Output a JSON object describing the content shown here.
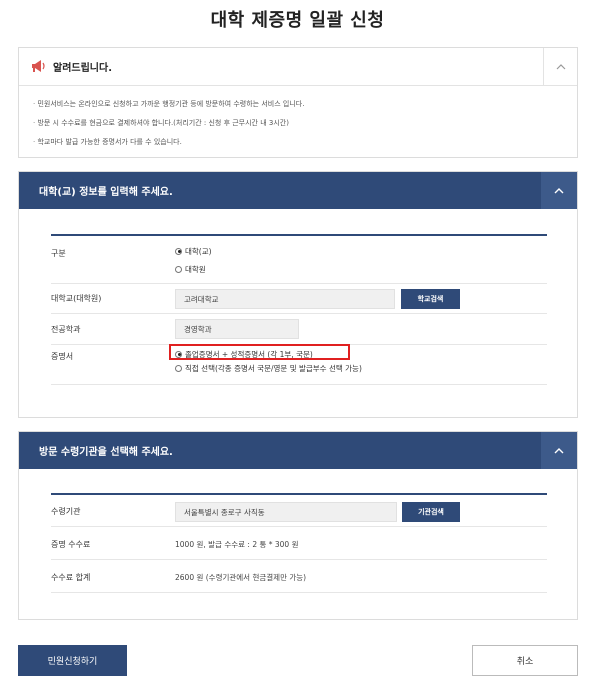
{
  "page": {
    "title": "대학 제증명 일괄 신청"
  },
  "notice": {
    "title": "알려드립니다.",
    "items": [
      "민원서비스는 온라인으로 신청하고 가까운 행정기관 등에 방문하여 수령하는 서비스 입니다.",
      "방문 시 수수료를 현금으로 결제하셔야 합니다.(처리기간 : 신청 후 근무시간 내 3시간)",
      "학교마다 발급 가능한 증명서가 다를 수 있습니다."
    ]
  },
  "school_section": {
    "title": "대학(교) 정보를 입력해 주세요.",
    "category_label": "구분",
    "category_options": [
      "대학(교)",
      "대학원"
    ],
    "category_selected": "대학(교)",
    "school_label": "대학교(대학원)",
    "school_value": "고려대학교",
    "school_search_label": "학교검색",
    "major_label": "전공학과",
    "major_value": "경영학과",
    "certificate_label": "증명서",
    "certificate_options": [
      "졸업증명서 + 성적증명서 (각 1부, 국문)",
      "직접 선택(각종 증명서 국문/영문 및 발급부수 선택 가능)"
    ],
    "certificate_selected": "졸업증명서 + 성적증명서 (각 1부, 국문)"
  },
  "office_section": {
    "title": "방문 수령기관을 선택해 주세요.",
    "office_label": "수령기관",
    "office_value": "서울특별시 종로구 사직동",
    "office_search_label": "기관검색",
    "fee_label": "증명 수수료",
    "fee_value": "1000 원, 발급 수수료 : 2 통 * 300 원",
    "total_label": "수수료 합계",
    "total_value": "2600 원 (수령기관에서 현금결제만 가능)"
  },
  "actions": {
    "apply_label": "민원신청하기",
    "cancel_label": "취소"
  },
  "colors": {
    "navy": "#2f4a78",
    "highlight": "#e02020"
  },
  "icons": {
    "notice": "megaphone-icon",
    "collapse": "chevron-up-icon"
  }
}
